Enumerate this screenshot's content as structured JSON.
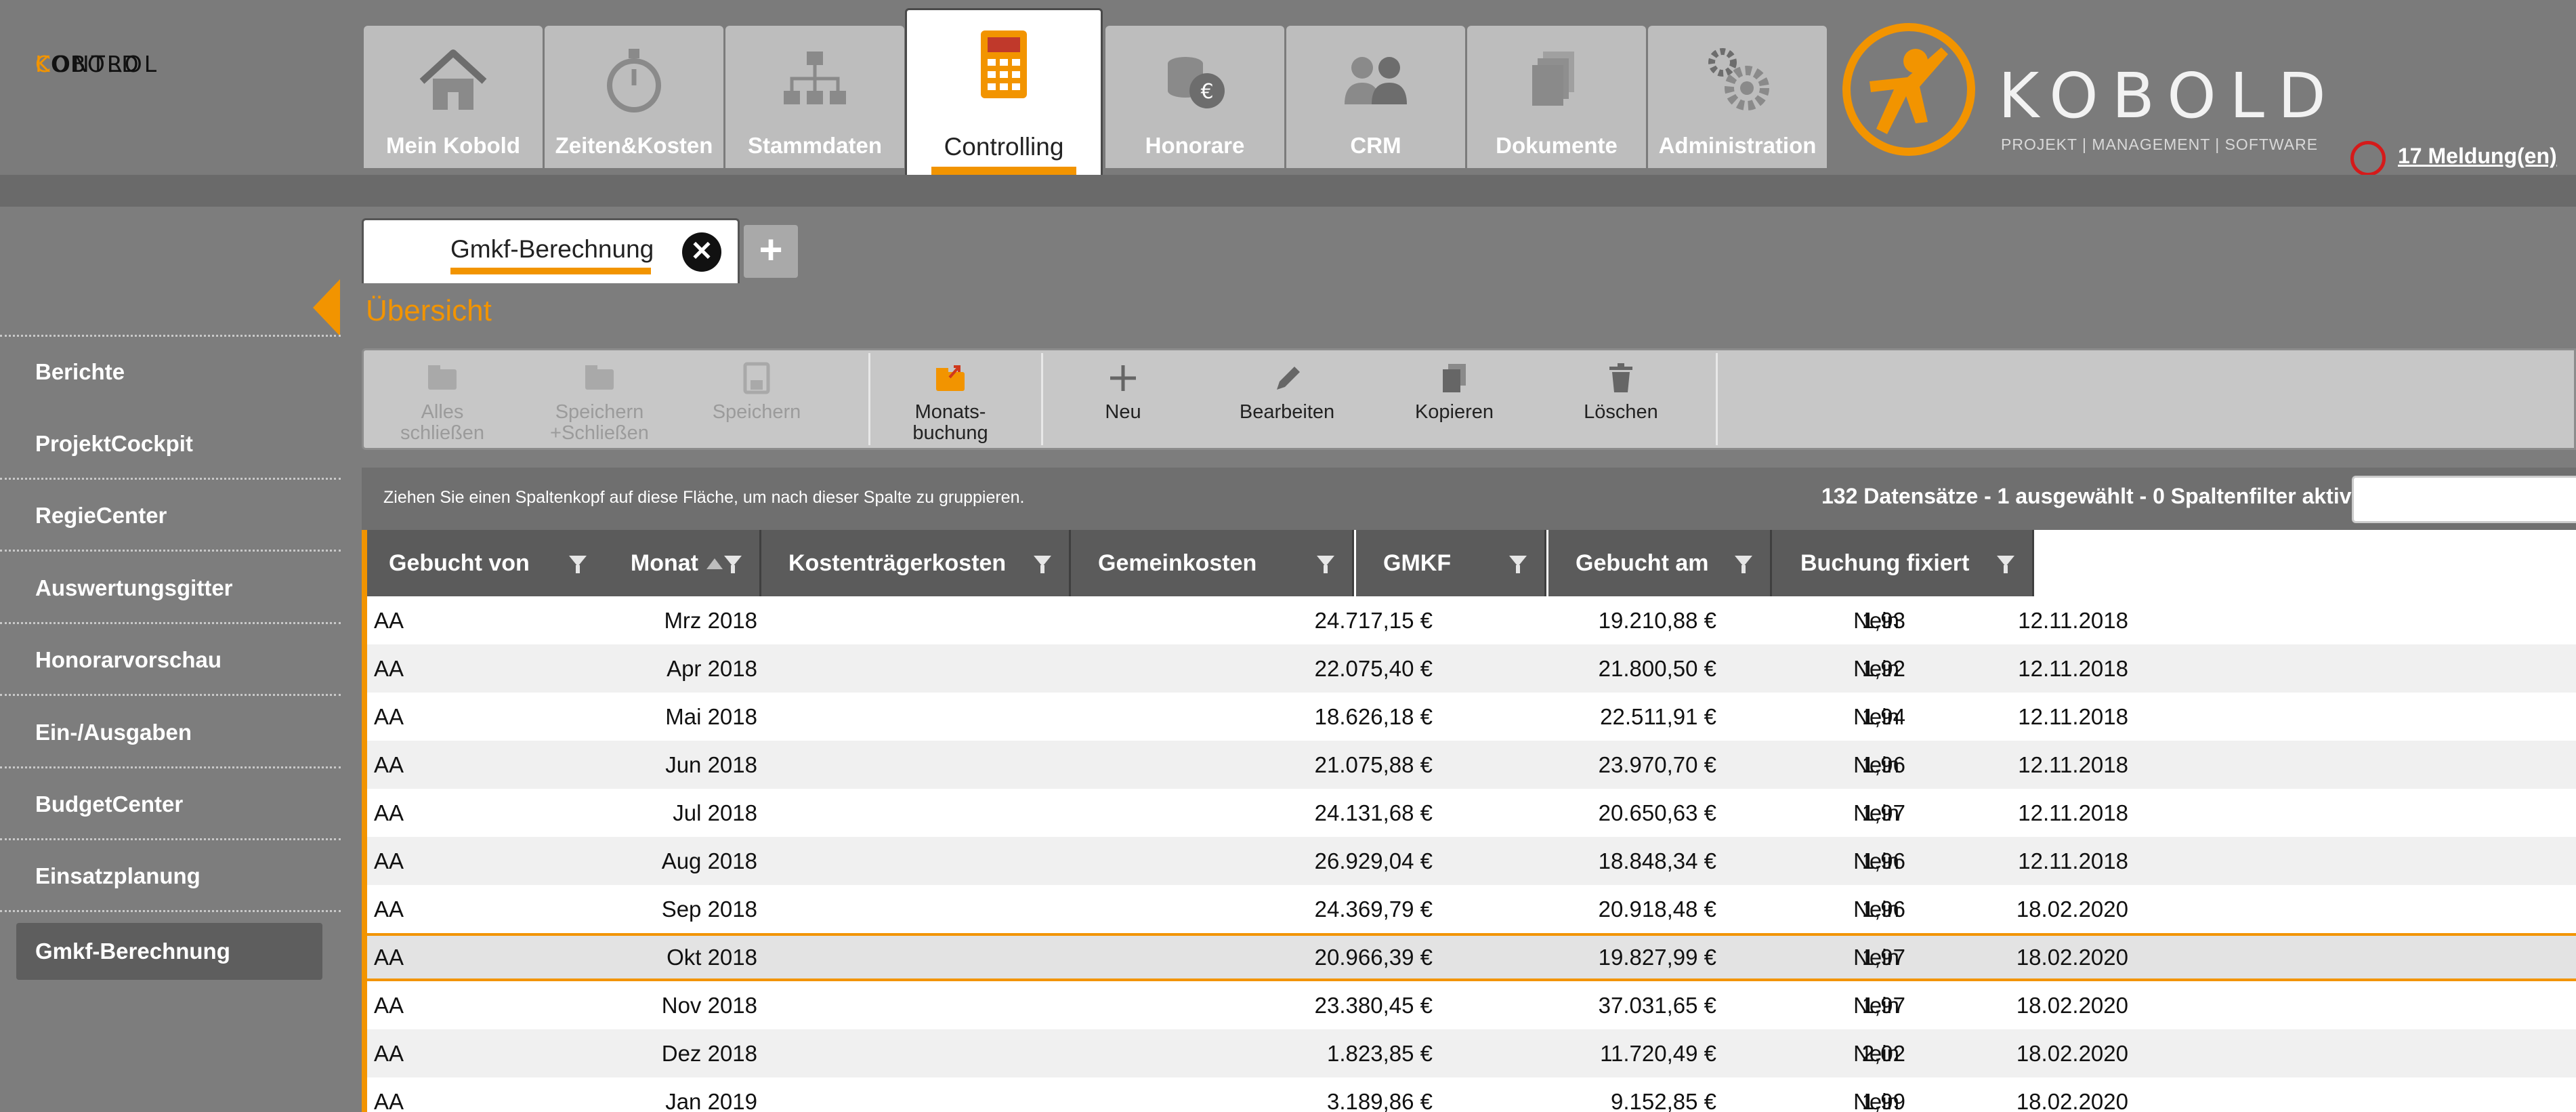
{
  "app": {
    "logo_initial_1": "K",
    "logo_rest_1": "OBOLD",
    "logo_initial_2": "C",
    "logo_rest_2": "ONTROL",
    "brand_name": "KOBOLD",
    "brand_tagline": "PROJEKT | MANAGEMENT | SOFTWARE",
    "notifications": "17 Meldung(en)"
  },
  "colors": {
    "accent": "#f29400",
    "header_bg": "#7b7b7b",
    "tab_bg": "#bdbdbd",
    "grid_header_bg": "#5b5b5b",
    "notification": "#d51a1a"
  },
  "nav": [
    {
      "label": "Mein Kobold",
      "icon": "home-icon"
    },
    {
      "label": "Zeiten&Kosten",
      "icon": "stopwatch-icon"
    },
    {
      "label": "Stammdaten",
      "icon": "org-chart-icon"
    },
    {
      "label": "Controlling",
      "icon": "calculator-icon",
      "active": true
    },
    {
      "label": "Honorare",
      "icon": "coins-euro-icon"
    },
    {
      "label": "CRM",
      "icon": "people-icon"
    },
    {
      "label": "Dokumente",
      "icon": "documents-icon"
    },
    {
      "label": "Administration",
      "icon": "gears-icon"
    }
  ],
  "sidebar": {
    "items": [
      {
        "label": "Berichte"
      },
      {
        "label": "ProjektCockpit"
      },
      {
        "label": "RegieCenter"
      },
      {
        "label": "Auswertungsgitter"
      },
      {
        "label": "Honorarvorschau"
      },
      {
        "label": "Ein-/Ausgaben"
      },
      {
        "label": "BudgetCenter"
      },
      {
        "label": "Einsatzplanung"
      },
      {
        "label": "Gmkf-Berechnung",
        "active": true
      }
    ]
  },
  "doc_tab": {
    "label": "Gmkf-Berechnung",
    "close": "✕",
    "add": "+"
  },
  "page": {
    "title": "Übersicht"
  },
  "toolbar": {
    "buttons": [
      {
        "label": "Alles\nschließen",
        "icon": "folder-close-all-icon",
        "enabled": false
      },
      {
        "label": "Speichern\n+Schließen",
        "icon": "folder-save-close-icon",
        "enabled": false
      },
      {
        "label": "Speichern",
        "icon": "save-icon",
        "enabled": false
      },
      {
        "label": "Monats-\nbuchung",
        "icon": "monthly-booking-icon",
        "enabled": true
      },
      {
        "label": "Neu",
        "icon": "plus-icon",
        "enabled": true
      },
      {
        "label": "Bearbeiten",
        "icon": "pencil-icon",
        "enabled": true
      },
      {
        "label": "Kopieren",
        "icon": "copy-icon",
        "enabled": true
      },
      {
        "label": "Löschen",
        "icon": "trash-icon",
        "enabled": true
      }
    ]
  },
  "grid": {
    "group_hint": "Ziehen Sie einen Spaltenkopf auf diese Fläche, um nach dieser Spalte zu gruppieren.",
    "record_info": "132 Datensätze - 1 ausgewählt - 0 Spaltenfilter aktiv",
    "search_value": "",
    "columns": [
      {
        "label": "Gebucht von"
      },
      {
        "label": "Monat",
        "sorted": "asc"
      },
      {
        "label": "Kostenträgerkosten"
      },
      {
        "label": "Gemeinkosten"
      },
      {
        "label": "GMKF"
      },
      {
        "label": "Gebucht am"
      },
      {
        "label": "Buchung fixiert"
      }
    ],
    "rows": [
      {
        "von": "AA",
        "monat": "Mrz 2018",
        "kt": "24.717,15 €",
        "gk": "19.210,88 €",
        "gmkf": "1,93",
        "am": "12.11.2018",
        "fix": "Nein"
      },
      {
        "von": "AA",
        "monat": "Apr 2018",
        "kt": "22.075,40 €",
        "gk": "21.800,50 €",
        "gmkf": "1,92",
        "am": "12.11.2018",
        "fix": "Nein"
      },
      {
        "von": "AA",
        "monat": "Mai 2018",
        "kt": "18.626,18 €",
        "gk": "22.511,91 €",
        "gmkf": "1,94",
        "am": "12.11.2018",
        "fix": "Nein"
      },
      {
        "von": "AA",
        "monat": "Jun 2018",
        "kt": "21.075,88 €",
        "gk": "23.970,70 €",
        "gmkf": "1,96",
        "am": "12.11.2018",
        "fix": "Nein"
      },
      {
        "von": "AA",
        "monat": "Jul 2018",
        "kt": "24.131,68 €",
        "gk": "20.650,63 €",
        "gmkf": "1,97",
        "am": "12.11.2018",
        "fix": "Nein"
      },
      {
        "von": "AA",
        "monat": "Aug 2018",
        "kt": "26.929,04 €",
        "gk": "18.848,34 €",
        "gmkf": "1,96",
        "am": "12.11.2018",
        "fix": "Nein"
      },
      {
        "von": "AA",
        "monat": "Sep 2018",
        "kt": "24.369,79 €",
        "gk": "20.918,48 €",
        "gmkf": "1,96",
        "am": "18.02.2020",
        "fix": "Nein"
      },
      {
        "von": "AA",
        "monat": "Okt 2018",
        "kt": "20.966,39 €",
        "gk": "19.827,99 €",
        "gmkf": "1,97",
        "am": "18.02.2020",
        "fix": "Nein",
        "selected": true
      },
      {
        "von": "AA",
        "monat": "Nov 2018",
        "kt": "23.380,45 €",
        "gk": "37.031,65 €",
        "gmkf": "1,97",
        "am": "18.02.2020",
        "fix": "Nein"
      },
      {
        "von": "AA",
        "monat": "Dez 2018",
        "kt": "1.823,85 €",
        "gk": "11.720,49 €",
        "gmkf": "2,02",
        "am": "18.02.2020",
        "fix": "Nein"
      },
      {
        "von": "AA",
        "monat": "Jan 2019",
        "kt": "3.189,86 €",
        "gk": "9.152,85 €",
        "gmkf": "1,99",
        "am": "18.02.2020",
        "fix": "Nein"
      }
    ]
  }
}
